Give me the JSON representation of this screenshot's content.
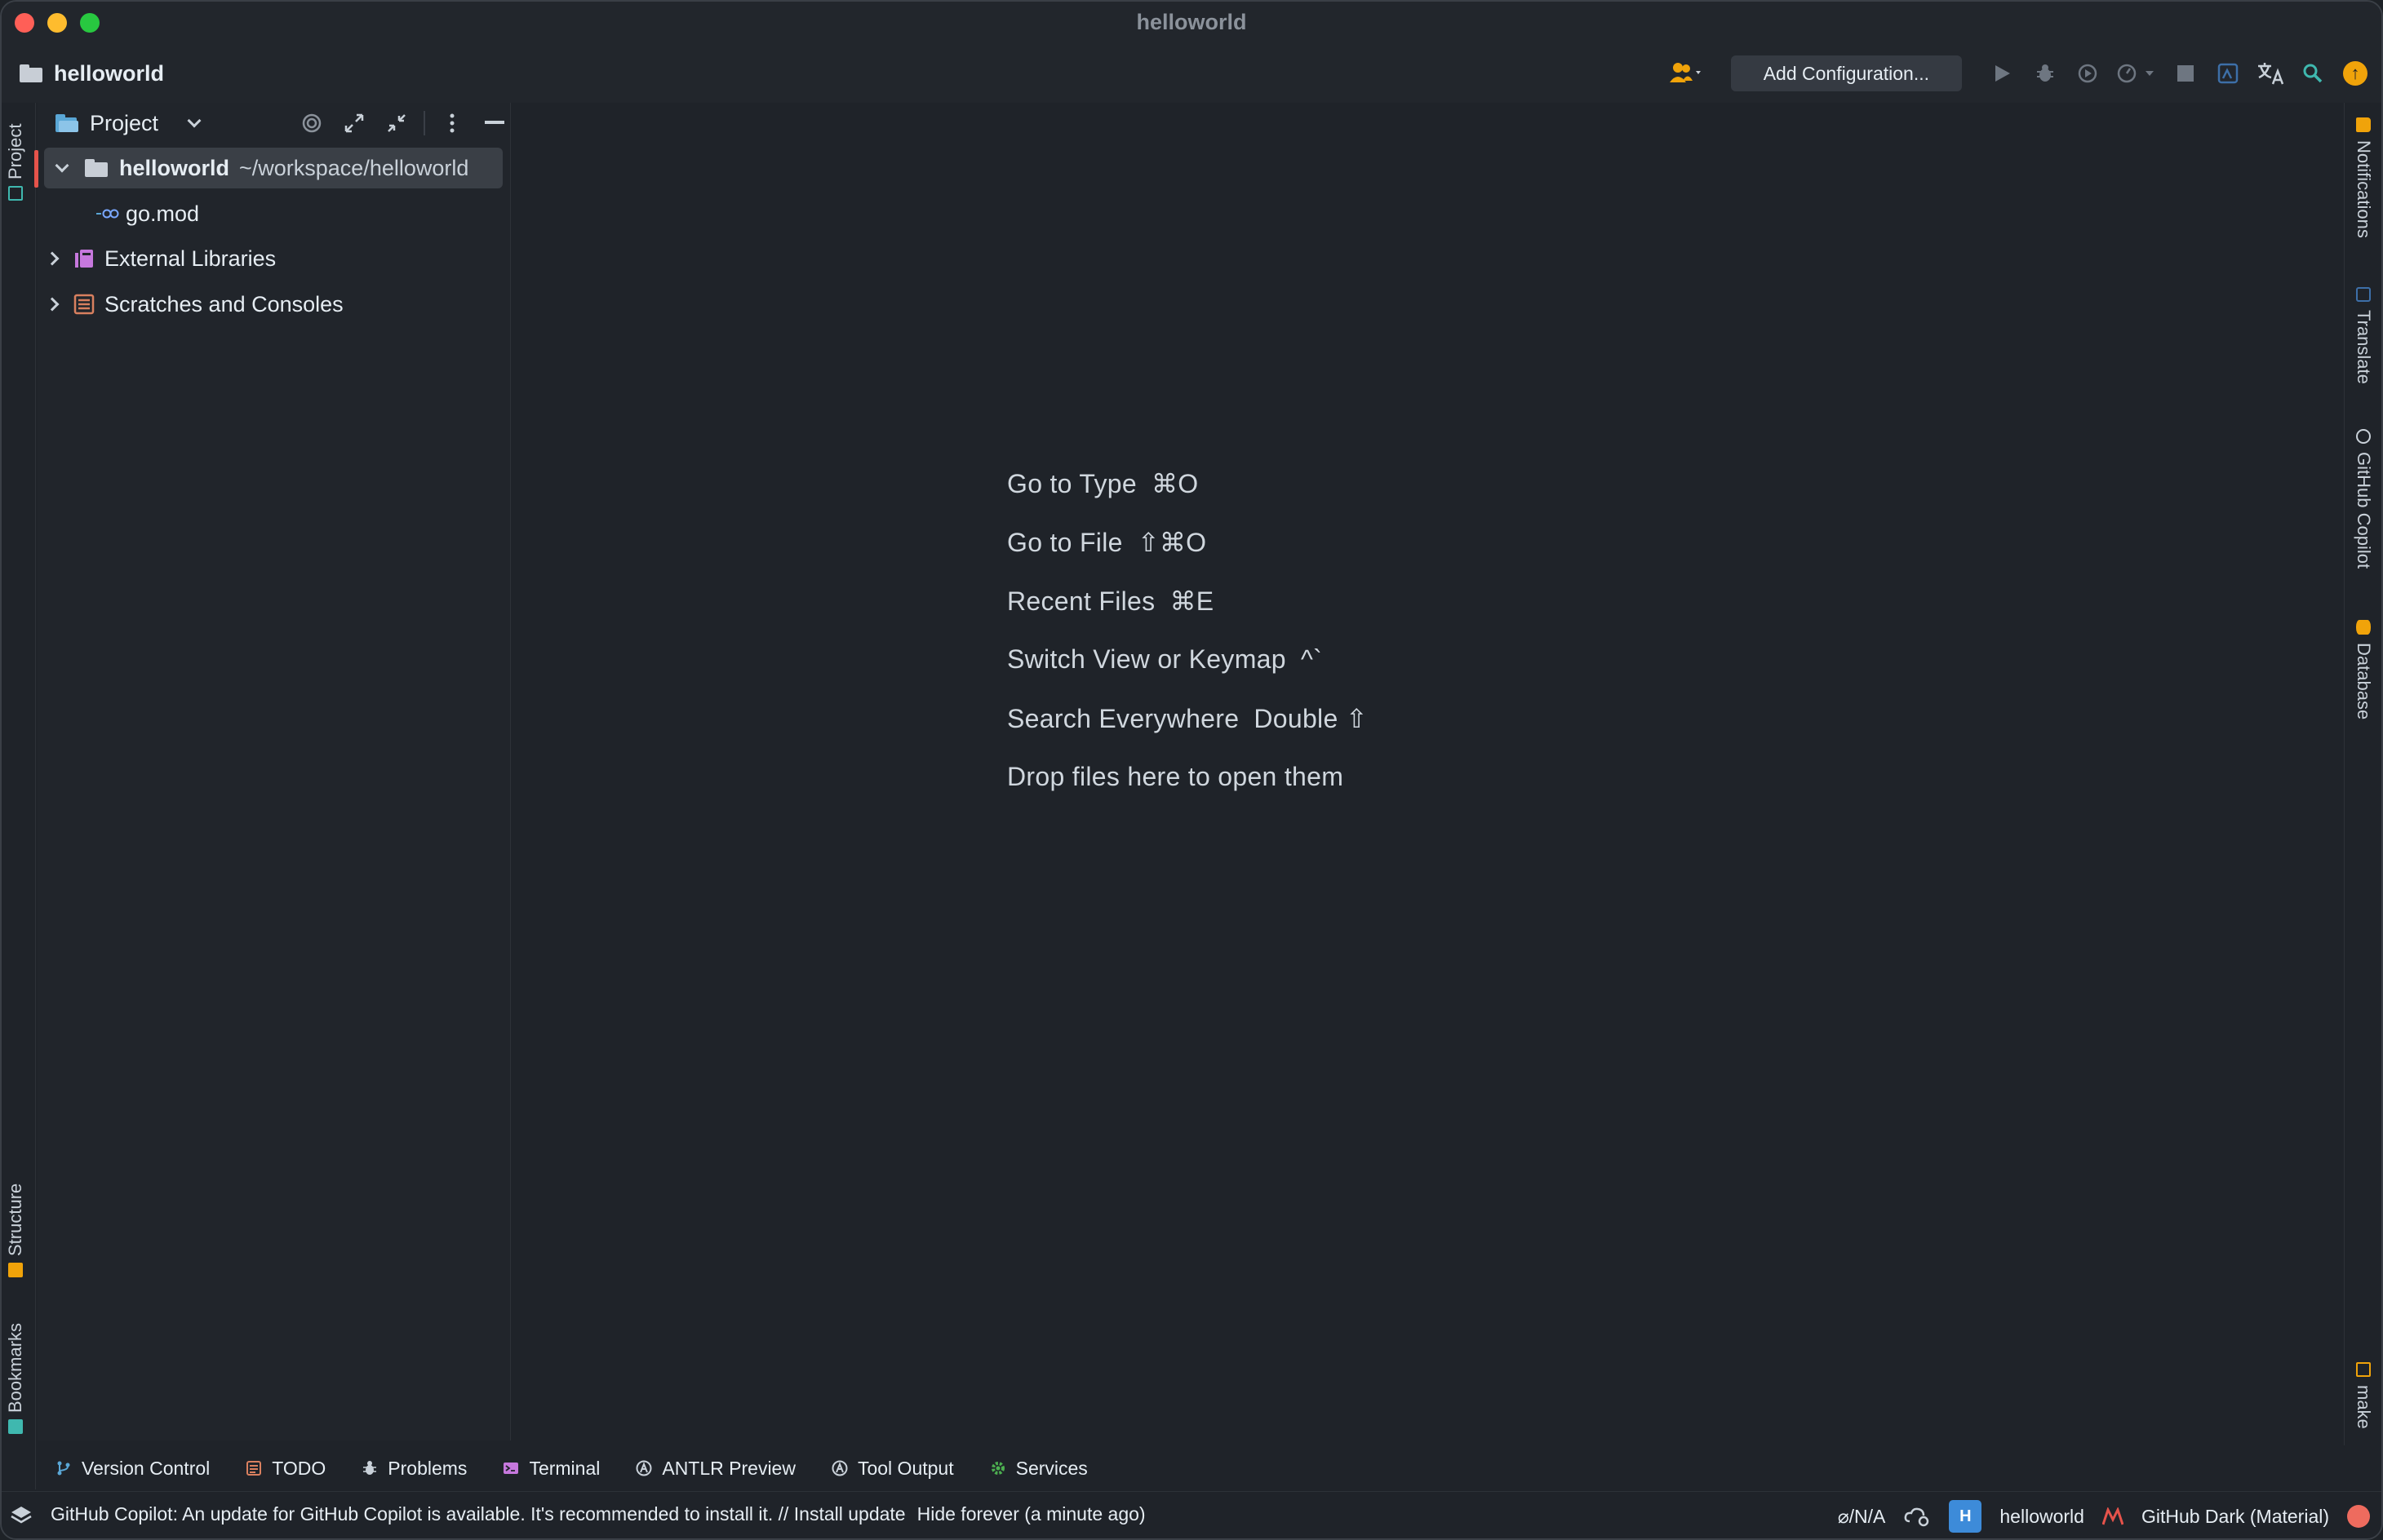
{
  "window": {
    "title": "helloworld"
  },
  "toolbar": {
    "project_name": "helloworld",
    "add_configuration_label": "Add Configuration...",
    "update_glyph": "↑"
  },
  "left_stripe": {
    "project_tab": "Project",
    "structure_tab": "Structure",
    "bookmarks_tab": "Bookmarks"
  },
  "right_stripe": {
    "notifications_tab": "Notifications",
    "translate_tab": "Translate",
    "copilot_tab": "GitHub Copilot",
    "database_tab": "Database",
    "make_tab": "make"
  },
  "project_panel": {
    "title": "Project",
    "tree": [
      {
        "name": "helloworld",
        "path": "~/workspace/helloworld"
      },
      {
        "name": "go.mod"
      },
      {
        "name": "External Libraries"
      },
      {
        "name": "Scratches and Consoles"
      }
    ]
  },
  "editor_hints": [
    {
      "label": "Go to Type",
      "shortcut": "⌘O"
    },
    {
      "label": "Go to File",
      "shortcut": "⇧⌘O"
    },
    {
      "label": "Recent Files",
      "shortcut": "⌘E"
    },
    {
      "label": "Switch View or Keymap",
      "shortcut": "^`"
    },
    {
      "label": "Search Everywhere",
      "shortcut": "Double ⇧"
    },
    {
      "label": "Drop files here to open them",
      "shortcut": ""
    }
  ],
  "bottom_tabs": [
    {
      "label": "Version Control",
      "icon": "git-branch-icon"
    },
    {
      "label": "TODO",
      "icon": "todo-icon"
    },
    {
      "label": "Problems",
      "icon": "bug-icon"
    },
    {
      "label": "Terminal",
      "icon": "terminal-icon"
    },
    {
      "label": "ANTLR Preview",
      "icon": "antlr-icon"
    },
    {
      "label": "Tool Output",
      "icon": "antlr-icon"
    },
    {
      "label": "Services",
      "icon": "gear-icon"
    }
  ],
  "status": {
    "message": "GitHub Copilot: An update for GitHub Copilot is available. It's recommended to install it. // Install update",
    "hide_link": "Hide forever (a minute ago)",
    "na_label": "⌀/N/A",
    "project_badge": "H",
    "project_label": "helloworld",
    "theme_label": "GitHub Dark (Material)"
  },
  "colors": {
    "background": "#1f2329",
    "accent_orange": "#f0a30a",
    "selection_marker": "#e5534b",
    "project_badge": "#3d8bd9"
  }
}
